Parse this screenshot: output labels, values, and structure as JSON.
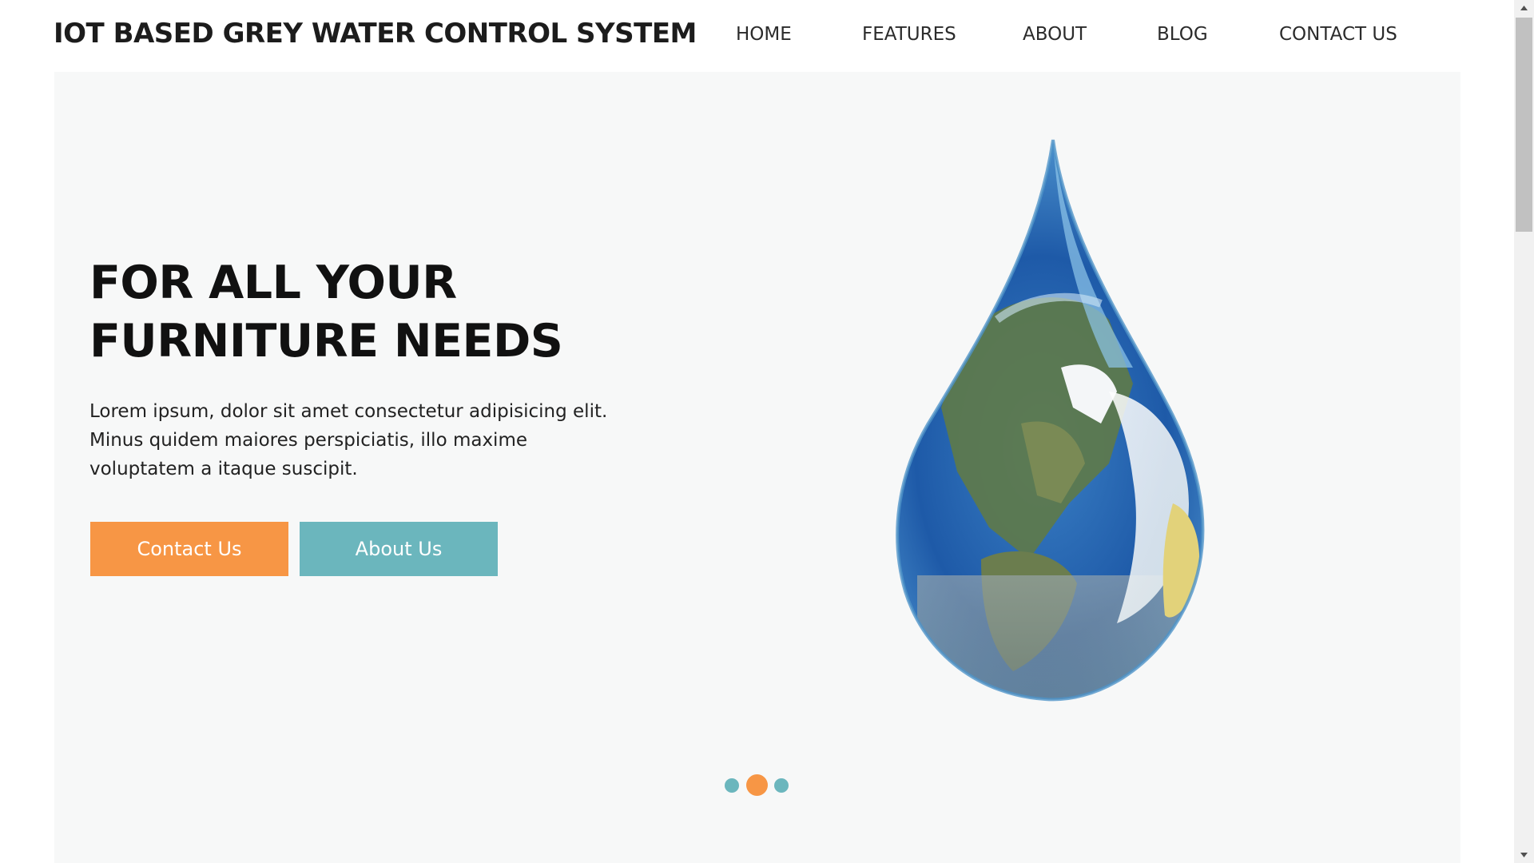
{
  "header": {
    "title": "IOT BASED GREY WATER CONTROL SYSTEM",
    "nav": [
      "HOME",
      "FEATURES",
      "ABOUT",
      "BLOG",
      "CONTACT US"
    ]
  },
  "hero": {
    "heading_line1": "FOR ALL YOUR",
    "heading_line2": "FURNITURE NEEDS",
    "text_line1": "Lorem ipsum, dolor sit amet consectetur adipisicing elit.",
    "text_line2": "Minus quidem maiores perspiciatis, illo maxime",
    "text_line3": "voluptatem a itaque suscipit.",
    "contact_button": "Contact Us",
    "about_button": "About Us",
    "image_icon": "water-drop-earth-icon"
  },
  "carousel": {
    "slides_count": 3,
    "active_index": 1
  },
  "colors": {
    "accent_orange": "#f79645",
    "accent_teal": "#6bb6bd",
    "hero_bg": "#f7f8f8"
  }
}
